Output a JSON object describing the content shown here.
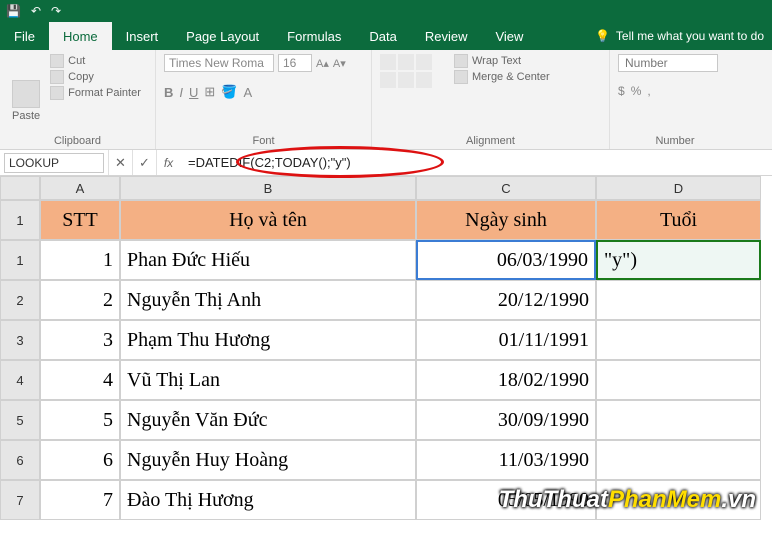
{
  "titlebar": {
    "save_icon": "💾",
    "undo_icon": "↶",
    "redo_icon": "↷"
  },
  "tabs": {
    "file": "File",
    "home": "Home",
    "insert": "Insert",
    "page_layout": "Page Layout",
    "formulas": "Formulas",
    "data": "Data",
    "review": "Review",
    "view": "View",
    "tellme": "Tell me what you want to do"
  },
  "ribbon": {
    "clipboard": {
      "label": "Clipboard",
      "paste": "Paste",
      "cut": "Cut",
      "copy": "Copy",
      "painter": "Format Painter"
    },
    "font": {
      "label": "Font",
      "name": "Times New Roma",
      "size": "16",
      "b": "B",
      "i": "I",
      "u": "U"
    },
    "alignment": {
      "label": "Alignment",
      "wrap": "Wrap Text",
      "merge": "Merge & Center"
    },
    "number": {
      "label": "Number",
      "format": "Number"
    }
  },
  "formula_bar": {
    "namebox": "LOOKUP",
    "cancel": "✕",
    "enter": "✓",
    "fx": "fx",
    "formula": "=DATEDIF(C2;TODAY();\"y\")"
  },
  "sheet": {
    "cols": [
      "A",
      "B",
      "C",
      "D"
    ],
    "header_row": {
      "a": "STT",
      "b": "Họ và tên",
      "c": "Ngày sinh",
      "d": "Tuổi"
    },
    "rows": [
      {
        "n": "1",
        "a": "1",
        "b": "Phan Đức Hiếu",
        "c": "06/03/1990",
        "d": "\"y\")"
      },
      {
        "n": "2",
        "a": "2",
        "b": "Nguyễn Thị Anh",
        "c": "20/12/1990",
        "d": ""
      },
      {
        "n": "3",
        "a": "3",
        "b": "Phạm Thu Hương",
        "c": "01/11/1991",
        "d": ""
      },
      {
        "n": "4",
        "a": "4",
        "b": "Vũ Thị Lan",
        "c": "18/02/1990",
        "d": ""
      },
      {
        "n": "5",
        "a": "5",
        "b": "Nguyễn Văn Đức",
        "c": "30/09/1990",
        "d": ""
      },
      {
        "n": "6",
        "a": "6",
        "b": "Nguyễn Huy Hoàng",
        "c": "11/03/1990",
        "d": ""
      },
      {
        "n": "7",
        "a": "7",
        "b": "Đào Thị Hương",
        "c": "05/05/1990",
        "d": ""
      }
    ]
  },
  "watermark": {
    "part1": "ThuThuat",
    "part2": "PhanMem",
    "part3": ".vn"
  }
}
